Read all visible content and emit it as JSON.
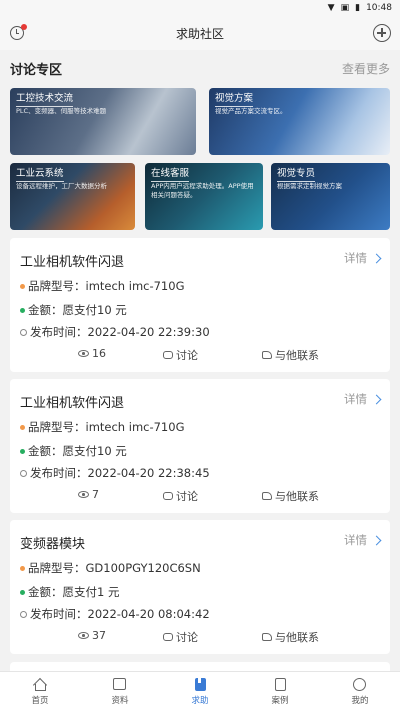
{
  "status_bar": {
    "time": "10:48"
  },
  "header": {
    "title": "求助社区"
  },
  "discussion": {
    "title": "讨论专区",
    "more_label": "查看更多",
    "topics": [
      {
        "title": "工控技术交流",
        "desc": "PLC、变频器、伺服等技术难题"
      },
      {
        "title": "视觉方案",
        "desc": "视觉产品方案交流专区。"
      },
      {
        "title": "工业云系统",
        "desc": "设备远程维护，工厂大数据分析"
      },
      {
        "title": "在线客服",
        "desc": "APP内用户远程求助处理。APP使用相关问题答疑。"
      },
      {
        "title": "视觉专员",
        "desc": "根据需求定制视觉方案"
      }
    ]
  },
  "posts": [
    {
      "title": "工业相机软件闪退",
      "detail_label": "详情",
      "brand_model": "品牌型号：imtech imc-710G",
      "amount": "金额：愿支付10 元",
      "published": "发布时间：2022-04-20 22:39:30",
      "views": "16",
      "discuss_label": "讨论",
      "contact_label": "与他联系"
    },
    {
      "title": "工业相机软件闪退",
      "detail_label": "详情",
      "brand_model": "品牌型号：imtech imc-710G",
      "amount": "金额：愿支付10 元",
      "published": "发布时间：2022-04-20 22:38:45",
      "views": "7",
      "discuss_label": "讨论",
      "contact_label": "与他联系"
    },
    {
      "title": "变频器模块",
      "detail_label": "详情",
      "brand_model": "品牌型号：GD100PGY120C6SN",
      "amount": "金额：愿支付1 元",
      "published": "发布时间：2022-04-20 08:04:42",
      "views": "37",
      "discuss_label": "讨论",
      "contact_label": "与他联系"
    }
  ],
  "tabbar": {
    "items": [
      {
        "label": "首页",
        "icon": "home-icon"
      },
      {
        "label": "资料",
        "icon": "document-icon"
      },
      {
        "label": "求助",
        "icon": "help-icon"
      },
      {
        "label": "案例",
        "icon": "case-icon"
      },
      {
        "label": "我的",
        "icon": "profile-icon"
      }
    ],
    "active_index": 2
  },
  "colors": {
    "accent": "#3a7bd5",
    "notification": "#e53935",
    "bullet_brand": "#f2994a",
    "bullet_amount": "#27ae60"
  }
}
